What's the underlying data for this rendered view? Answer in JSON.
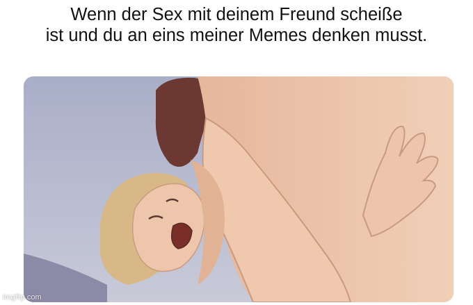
{
  "caption": {
    "line1": "Wenn der Sex mit deinem Freund scheiße",
    "line2": "ist und du an eins meiner Memes denken musst."
  },
  "watermark": "imgflip.com",
  "colors": {
    "background": "#ffffff",
    "sky": "#aeb3cc",
    "skin": "#e8bfa4",
    "skin_shadow": "#cf9f86",
    "hair_dark": "#6e3a32",
    "hair_blonde": "#d9b98a"
  }
}
